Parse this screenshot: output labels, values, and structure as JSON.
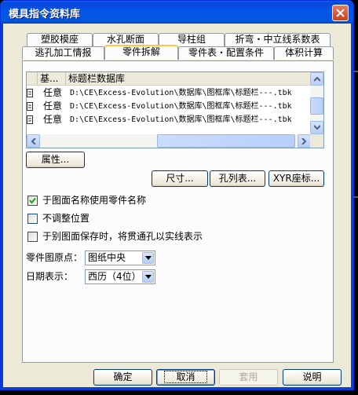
{
  "window": {
    "title": "模具指令资料库"
  },
  "tabs_row1": [
    {
      "label": "塑胶模座"
    },
    {
      "label": "水孔断面"
    },
    {
      "label": "导柱组"
    },
    {
      "label": "折弯・中立线系数表"
    }
  ],
  "tabs_row2": [
    {
      "label": "逃孔加工情报"
    },
    {
      "label": "零件拆解",
      "active": true
    },
    {
      "label": "零件表・配置条件"
    },
    {
      "label": "体积计算"
    }
  ],
  "list": {
    "columns": [
      "",
      "基...",
      "标题栏数据库"
    ],
    "rows": [
      {
        "icon": "",
        "type": "任意",
        "path": "D:\\CE\\Excess-Evolution\\数据库\\图框库\\标题栏---.tbk"
      },
      {
        "icon": "",
        "type": "任意",
        "path": "D:\\CE\\Excess-Evolution\\数据库\\图框库\\标题栏---.tbk"
      },
      {
        "icon": "",
        "type": "任意",
        "path": "D:\\CE\\Excess-Evolution\\数据库\\图框库\\标题栏---.tbk"
      }
    ]
  },
  "buttons": {
    "properties": "属性...",
    "dimension": "尺寸...",
    "hole_table": "孔列表...",
    "xyr": "XYR座标..."
  },
  "options": [
    {
      "label": "于图面名称使用零件名称",
      "checked": true
    },
    {
      "label": "不调整位置",
      "checked": false
    },
    {
      "label": "于别图面保存时，将贯通孔以实线表示",
      "checked": false
    }
  ],
  "fields": {
    "origin_label": "零件图原点：",
    "origin_value": "图纸中央",
    "date_label": "日期表示：",
    "date_value": "西历（4位）"
  },
  "footer": {
    "ok": "确定",
    "cancel": "取消",
    "apply": "套用",
    "help": "说明"
  }
}
